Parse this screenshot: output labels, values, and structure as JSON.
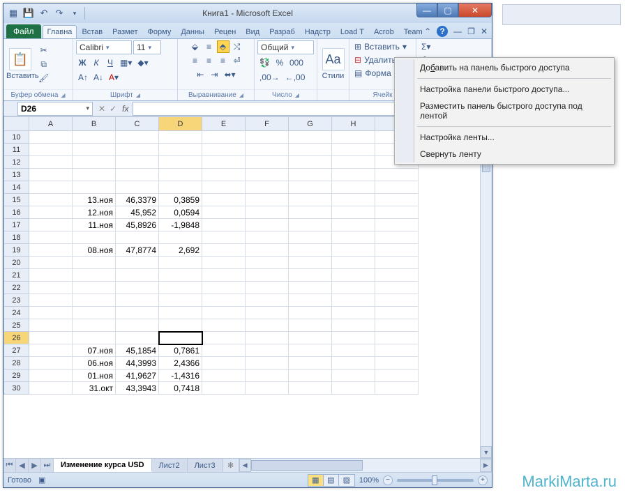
{
  "window": {
    "title": "Книга1 - Microsoft Excel"
  },
  "qat": {
    "save": "💾",
    "undo": "↶",
    "redo": "↷"
  },
  "tabs": {
    "file": "Файл",
    "list": [
      "Главна",
      "Встав",
      "Размет",
      "Форму",
      "Данны",
      "Рецен",
      "Вид",
      "Разраб",
      "Надстр",
      "Load T",
      "Acrob",
      "Team"
    ],
    "active_index": 0
  },
  "ribbon": {
    "clipboard": {
      "paste": "Вставить",
      "label": "Буфер обмена"
    },
    "font": {
      "name": "Calibri",
      "size": "11",
      "bold": "Ж",
      "italic": "К",
      "underline": "Ч",
      "label": "Шрифт"
    },
    "alignment": {
      "label": "Выравнивание"
    },
    "number": {
      "format": "Общий",
      "label": "Число"
    },
    "styles": {
      "btn": "Стили"
    },
    "cells": {
      "insert": "Вставить",
      "delete": "Удалить",
      "format": "Форма",
      "label": "Ячейк"
    },
    "editing": {
      "sum": "Σ"
    }
  },
  "namebox": "D26",
  "columns": [
    "A",
    "B",
    "C",
    "D",
    "E",
    "F",
    "G",
    "H"
  ],
  "active_col_index": 3,
  "row_start": 10,
  "row_end": 30,
  "active_row": 26,
  "cells": {
    "15": {
      "B": "13.ноя",
      "C": "46,3379",
      "D": "0,3859"
    },
    "16": {
      "B": "12.ноя",
      "C": "45,952",
      "D": "0,0594"
    },
    "17": {
      "B": "11.ноя",
      "C": "45,8926",
      "D": "-1,9848"
    },
    "19": {
      "B": "08.ноя",
      "C": "47,8774",
      "D": "2,692"
    },
    "27": {
      "B": "07.ноя",
      "C": "45,1854",
      "D": "0,7861"
    },
    "28": {
      "B": "06.ноя",
      "C": "44,3993",
      "D": "2,4366"
    },
    "29": {
      "B": "01.ноя",
      "C": "41,9627",
      "D": "-1,4316"
    },
    "30": {
      "B": "31.окт",
      "C": "43,3943",
      "D": "0,7418"
    }
  },
  "sheets": {
    "list": [
      "Изменение курса USD",
      "Лист2",
      "Лист3"
    ],
    "active_index": 0
  },
  "status": {
    "ready": "Готово",
    "zoom": "100%"
  },
  "context_menu": {
    "add_qat": "Добавить на панель быстрого доступа",
    "customize_qat": "Настройка панели быстрого доступа...",
    "below_ribbon": "Разместить панель быстрого доступа под лентой",
    "customize_ribbon": "Настройка ленты...",
    "minimize_ribbon": "Свернуть ленту"
  },
  "watermark": "MarkiMarta.ru"
}
